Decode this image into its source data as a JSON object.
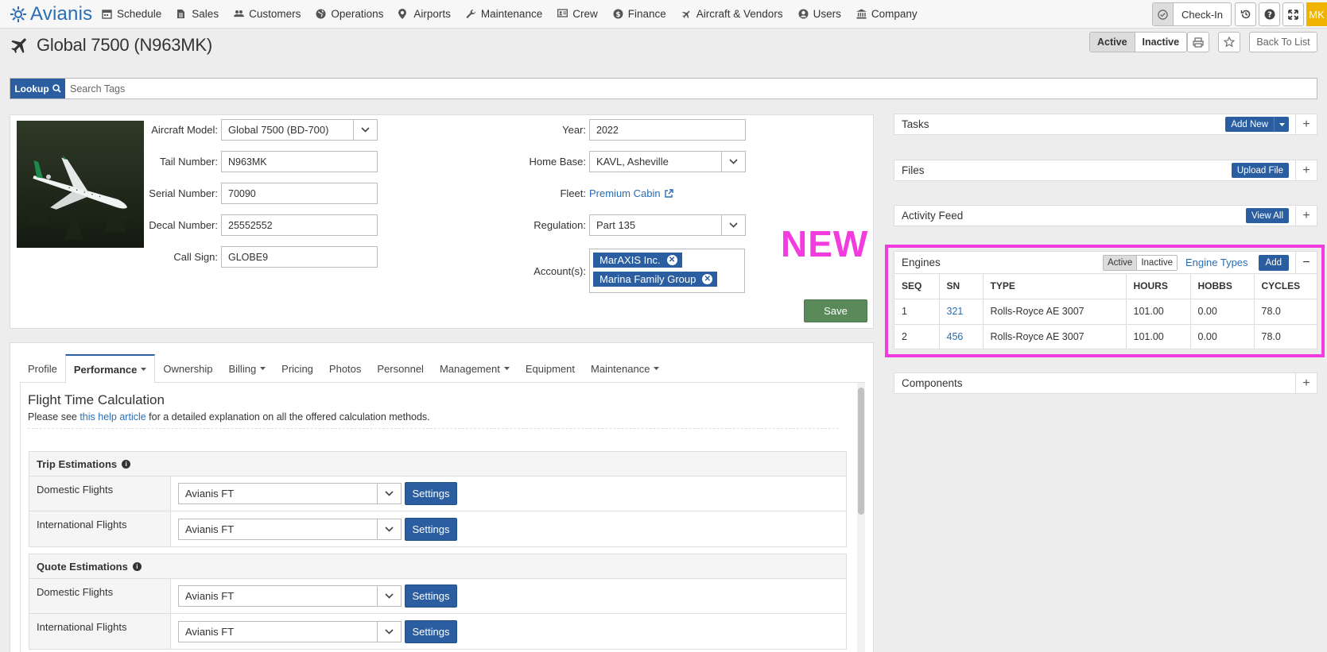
{
  "brand": {
    "name": "Avianis"
  },
  "nav": [
    {
      "label": "Schedule",
      "icon": "calendar-icon"
    },
    {
      "label": "Sales",
      "icon": "document-icon"
    },
    {
      "label": "Customers",
      "icon": "users-icon"
    },
    {
      "label": "Operations",
      "icon": "globe-icon"
    },
    {
      "label": "Airports",
      "icon": "map-pin-icon"
    },
    {
      "label": "Maintenance",
      "icon": "wrench-icon"
    },
    {
      "label": "Crew",
      "icon": "id-card-icon"
    },
    {
      "label": "Finance",
      "icon": "dollar-icon"
    },
    {
      "label": "Aircraft & Vendors",
      "icon": "plane-icon"
    },
    {
      "label": "Users",
      "icon": "user-circle-icon"
    },
    {
      "label": "Company",
      "icon": "building-icon"
    }
  ],
  "topright": {
    "checkin_label": "Check-In",
    "avatar_initials": "MK"
  },
  "header": {
    "title": "Global 7500 (N963MK)",
    "status_active": "Active",
    "status_inactive": "Inactive",
    "back_label": "Back To List"
  },
  "lookup": {
    "button_label": "Lookup",
    "placeholder": "Search Tags"
  },
  "aircraft": {
    "model_label": "Aircraft Model:",
    "model_value": "Global 7500 (BD-700)",
    "tail_label": "Tail Number:",
    "tail_value": "N963MK",
    "serial_label": "Serial Number:",
    "serial_value": "70090",
    "decal_label": "Decal Number:",
    "decal_value": "25552552",
    "callsign_label": "Call Sign:",
    "callsign_value": "GLOBE9",
    "year_label": "Year:",
    "year_value": "2022",
    "homebase_label": "Home Base:",
    "homebase_value": "KAVL, Asheville",
    "fleet_label": "Fleet:",
    "fleet_value": "Premium Cabin",
    "regulation_label": "Regulation:",
    "regulation_value": "Part 135",
    "accounts_label": "Account(s):",
    "accounts": [
      "MarAXIS Inc.",
      "Marina Family Group"
    ],
    "save_label": "Save"
  },
  "annotation": {
    "new_label": "NEW"
  },
  "tabs": [
    {
      "label": "Profile",
      "dropdown": false
    },
    {
      "label": "Performance",
      "dropdown": true
    },
    {
      "label": "Ownership",
      "dropdown": false
    },
    {
      "label": "Billing",
      "dropdown": true
    },
    {
      "label": "Pricing",
      "dropdown": false
    },
    {
      "label": "Photos",
      "dropdown": false
    },
    {
      "label": "Personnel",
      "dropdown": false
    },
    {
      "label": "Management",
      "dropdown": true
    },
    {
      "label": "Equipment",
      "dropdown": false
    },
    {
      "label": "Maintenance",
      "dropdown": true
    }
  ],
  "performance": {
    "title": "Flight Time Calculation",
    "help_pre": "Please see ",
    "help_link": "this help article",
    "help_post": " for a detailed explanation on all the offered calculation methods.",
    "sections": [
      {
        "title": "Trip Estimations",
        "rows": [
          {
            "label": "Domestic Flights",
            "value": "Avianis FT",
            "button": "Settings"
          },
          {
            "label": "International Flights",
            "value": "Avianis FT",
            "button": "Settings"
          }
        ]
      },
      {
        "title": "Quote Estimations",
        "rows": [
          {
            "label": "Domestic Flights",
            "value": "Avianis FT",
            "button": "Settings"
          },
          {
            "label": "International Flights",
            "value": "Avianis FT",
            "button": "Settings"
          }
        ]
      }
    ]
  },
  "side": {
    "tasks": {
      "title": "Tasks",
      "button": "Add New"
    },
    "files": {
      "title": "Files",
      "button": "Upload File"
    },
    "activity": {
      "title": "Activity Feed",
      "button": "View All"
    },
    "components": {
      "title": "Components"
    }
  },
  "engines": {
    "title": "Engines",
    "toggle_active": "Active",
    "toggle_inactive": "Inactive",
    "types_link": "Engine Types",
    "add_label": "Add",
    "columns": [
      "SEQ",
      "SN",
      "TYPE",
      "HOURS",
      "HOBBS",
      "CYCLES"
    ],
    "rows": [
      {
        "seq": "1",
        "sn": "321",
        "type": "Rolls-Royce AE 3007",
        "hours": "101.00",
        "hobbs": "0.00",
        "cycles": "78.0"
      },
      {
        "seq": "2",
        "sn": "456",
        "type": "Rolls-Royce AE 3007",
        "hours": "101.00",
        "hobbs": "0.00",
        "cycles": "78.0"
      }
    ]
  },
  "colors": {
    "primary": "#2a5ea0",
    "success": "#5a8a5a",
    "highlight": "#f33ce0",
    "avatar": "#f0b400"
  }
}
